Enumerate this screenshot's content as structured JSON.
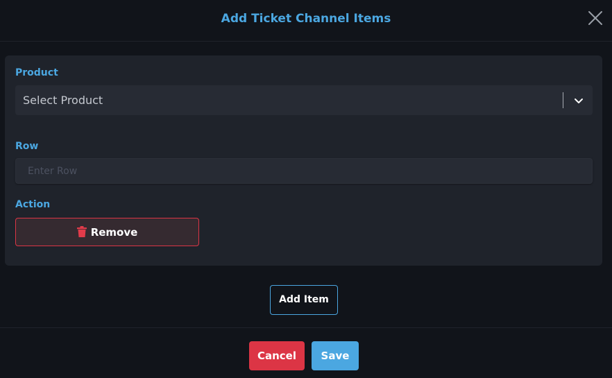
{
  "modal": {
    "title": "Add Ticket Channel Items",
    "close_icon": "close-icon"
  },
  "form": {
    "product": {
      "label": "Product",
      "selected": "Select Product",
      "icon": "chevron-down-icon"
    },
    "row": {
      "label": "Row",
      "placeholder": "Enter Row",
      "value": ""
    },
    "action": {
      "label": "Action",
      "remove_label": "Remove",
      "remove_icon": "trash-icon"
    }
  },
  "add_item_label": "Add Item",
  "footer": {
    "cancel_label": "Cancel",
    "save_label": "Save"
  },
  "colors": {
    "accent": "#4ba7e1",
    "danger": "#dc3545",
    "background": "#11141a",
    "card": "#1f232b"
  }
}
